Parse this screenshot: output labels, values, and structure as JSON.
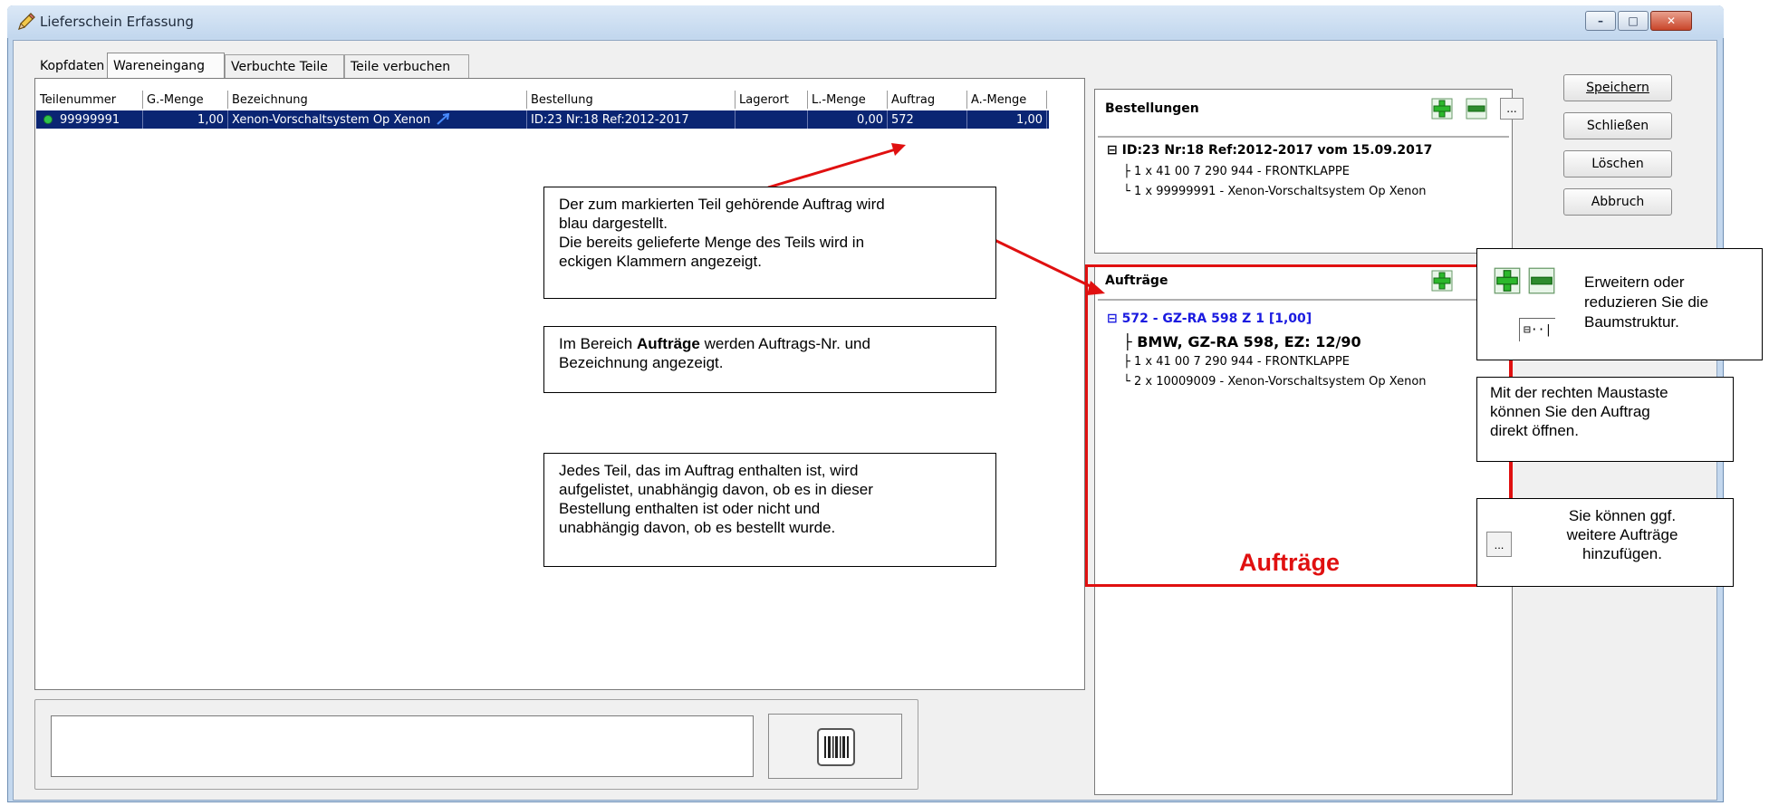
{
  "window": {
    "title": "Lieferschein Erfassung",
    "min_label": "–",
    "max_label": "□",
    "close_label": "✕"
  },
  "tabs": [
    "Kopfdaten",
    "Wareneingang",
    "Verbuchte Teile",
    "Teile verbuchen"
  ],
  "table": {
    "headers": [
      "Teilenummer",
      "G.-Menge",
      "Bezeichnung",
      "Bestellung",
      "Lagerort",
      "L.-Menge",
      "Auftrag",
      "A.-Menge"
    ],
    "rows": [
      {
        "teilenummer": "99999991",
        "g_menge": "1,00",
        "bezeichnung": "Xenon-Vorschaltsystem Op Xenon",
        "bestellung": "ID:23 Nr:18 Ref:2012-2017",
        "lagerort": "",
        "l_menge": "0,00",
        "auftrag": "572",
        "a_menge": "1,00"
      }
    ]
  },
  "bestellungen": {
    "title": "Bestellungen",
    "more_label": "...",
    "tree": {
      "root": "ID:23 Nr:18 Ref:2012-2017 vom 15.09.2017",
      "children": [
        "1 x 41 00 7 290 944 - FRONTKLAPPE",
        "1 x 99999991 - Xenon-Vorschaltsystem Op Xenon"
      ]
    }
  },
  "auftraege": {
    "title": "Aufträge",
    "tree": {
      "root": "572 - GZ-RA 598 Z 1 [1,00]",
      "vehicle": "BMW,  GZ-RA 598, EZ: 12/90",
      "children": [
        "1 x 41 00 7 290 944 - FRONTKLAPPE",
        "2 x 10009009 - Xenon-Vorschaltsystem Op Xenon"
      ]
    }
  },
  "actions": [
    "Speichern",
    "Schließen",
    "Löschen",
    "Abbruch"
  ],
  "callouts": {
    "c1": [
      "Der zum markierten Teil gehörende Auftrag wird",
      "blau dargestellt.",
      "Die bereits gelieferte Menge des Teils wird in",
      "eckigen Klammern angezeigt."
    ],
    "c2_pre": "Im Bereich ",
    "c2_bold": "Aufträge",
    "c2_post": " werden Auftrags-Nr. und",
    "c2_line2": "Bezeichnung angezeigt.",
    "c3": [
      "Jedes Teil, das im Auftrag enthalten ist, wird",
      "aufgelistet, unabhängig davon, ob es in dieser",
      "Bestellung enthalten ist oder nicht  und",
      "unabhängig davon, ob es bestellt wurde."
    ],
    "c4": [
      "Erweitern oder",
      "reduzieren Sie die",
      "Baumstruktur."
    ],
    "c4_tree_glyph": "⊟··|",
    "c5": [
      "Mit der rechten Maustaste",
      "können Sie den Auftrag",
      "direkt öffnen."
    ],
    "c6": [
      "Sie können ggf.",
      "weitere  Aufträge",
      "hinzufügen."
    ],
    "c6_button": "...",
    "big_label": "Aufträge"
  },
  "colors": {
    "selection": "#0a2573",
    "highlight_blue": "#1a1ae0",
    "red": "#e01010",
    "plus_green": "#2cb82c",
    "minus_green": "#2e8b2e"
  },
  "icons": [
    "pencil-icon",
    "barcode-icon",
    "plus-icon",
    "minus-icon",
    "link-arrow-icon"
  ]
}
